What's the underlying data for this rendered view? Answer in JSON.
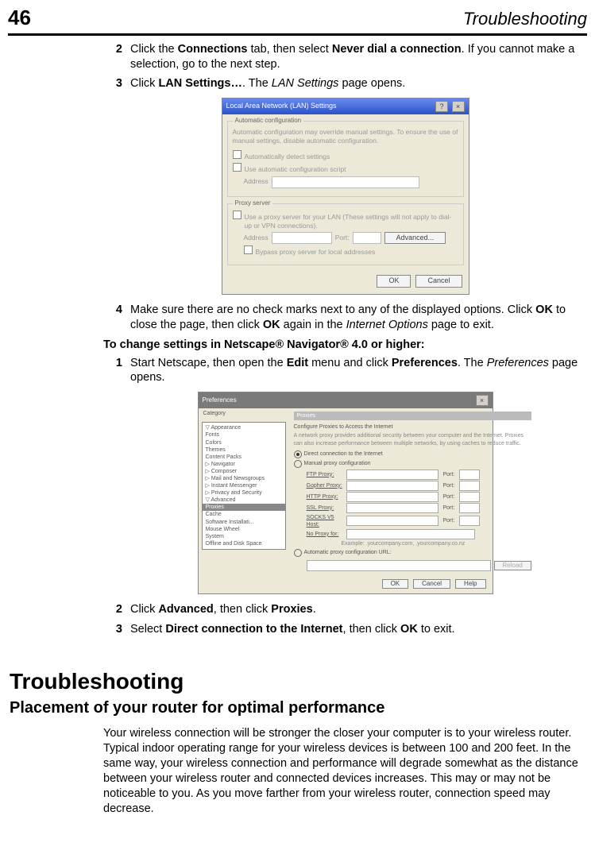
{
  "page_number": "46",
  "header_title": "Troubleshooting",
  "steps_a": [
    {
      "num": "2",
      "html": "Click the <b>Connections</b> tab, then select <b>Never dial a connection</b>. If you cannot make a selection, go to the next step."
    },
    {
      "num": "3",
      "html": "Click <b>LAN Settings…</b>. The <i>LAN Settings</i> page opens."
    }
  ],
  "step_a4": {
    "num": "4",
    "html": "Make sure there are no check marks next to any of the displayed options. Click <b>OK</b> to close the page, then click <b>OK</b> again in the <i>Internet Options</i> page to exit."
  },
  "netscape_heading": "To change settings in Netscape® Navigator® 4.0 or higher:",
  "step_b1": {
    "num": "1",
    "html": "Start Netscape, then open the <b>Edit</b> menu and click <b>Preferences</b>. The <i>Preferences</i> page opens."
  },
  "steps_b_after": [
    {
      "num": "2",
      "html": "Click <b>Advanced</b>, then click <b>Proxies</b>."
    },
    {
      "num": "3",
      "html": "Select <b>Direct connection to the Internet</b>, then click <b>OK</b> to exit."
    }
  ],
  "ts_h1": "Troubleshooting",
  "ts_h2": "Placement of your router for optimal performance",
  "ts_para": "Your wireless connection will be stronger the closer your computer is to your wireless router. Typical indoor operating range for your wireless devices is between 100 and 200 feet. In the same way, your wireless connection and performance will degrade somewhat as the distance between your wireless router and connected devices increases. This may or may not be noticeable to you. As you move farther from your wireless router, connection speed may decrease.",
  "dlg1": {
    "title": "Local Area Network (LAN) Settings",
    "auto_hdr": "Automatic configuration",
    "auto_desc": "Automatic configuration may override manual settings. To ensure the use of manual settings, disable automatic configuration.",
    "cb_detect": "Automatically detect settings",
    "cb_script": "Use automatic configuration script",
    "addr_label": "Address",
    "proxy_hdr": "Proxy server",
    "proxy_desc": "Use a proxy server for your LAN (These settings will not apply to dial-up or VPN connections).",
    "port_label": "Port:",
    "adv_btn": "Advanced...",
    "bypass": "Bypass proxy server for local addresses",
    "ok": "OK",
    "cancel": "Cancel"
  },
  "dlg2": {
    "title": "Preferences",
    "cat": "Category",
    "tree": [
      "Appearance",
      "Fonts",
      "Colors",
      "Themes",
      "Content Packs",
      "Navigator",
      "Composer",
      "Mail and Newsgroups",
      "Instant Messenger",
      "Privacy and Security",
      "Advanced",
      "Proxies",
      "Cache",
      "Software Installati...",
      "Mouse Wheel",
      "System",
      "Offline and Disk Space"
    ],
    "panel_hdr": "Proxies",
    "panel_sub": "Configure Proxies to Access the Internet",
    "panel_desc": "A network proxy provides additional security between your computer and the Internet. Proxies can also increase performance between multiple networks, by using caches to reduce traffic.",
    "r_direct": "Direct connection to the Internet",
    "r_manual": "Manual proxy configuration",
    "rows": [
      {
        "l": "FTP Proxy:",
        "p": "Port:"
      },
      {
        "l": "Gopher Proxy:",
        "p": "Port:"
      },
      {
        "l": "HTTP Proxy:",
        "p": "Port:"
      },
      {
        "l": "SSL Proxy:",
        "p": "Port:"
      },
      {
        "l": "SOCKS V5 Host:",
        "p": "Port:"
      }
    ],
    "noproxy": "No Proxy for:",
    "example": "Example: .yourcompany.com, .yourcompany.co.nz",
    "r_auto": "Automatic proxy configuration URL:",
    "reload": "Reload",
    "ok": "OK",
    "cancel": "Cancel",
    "help": "Help"
  }
}
